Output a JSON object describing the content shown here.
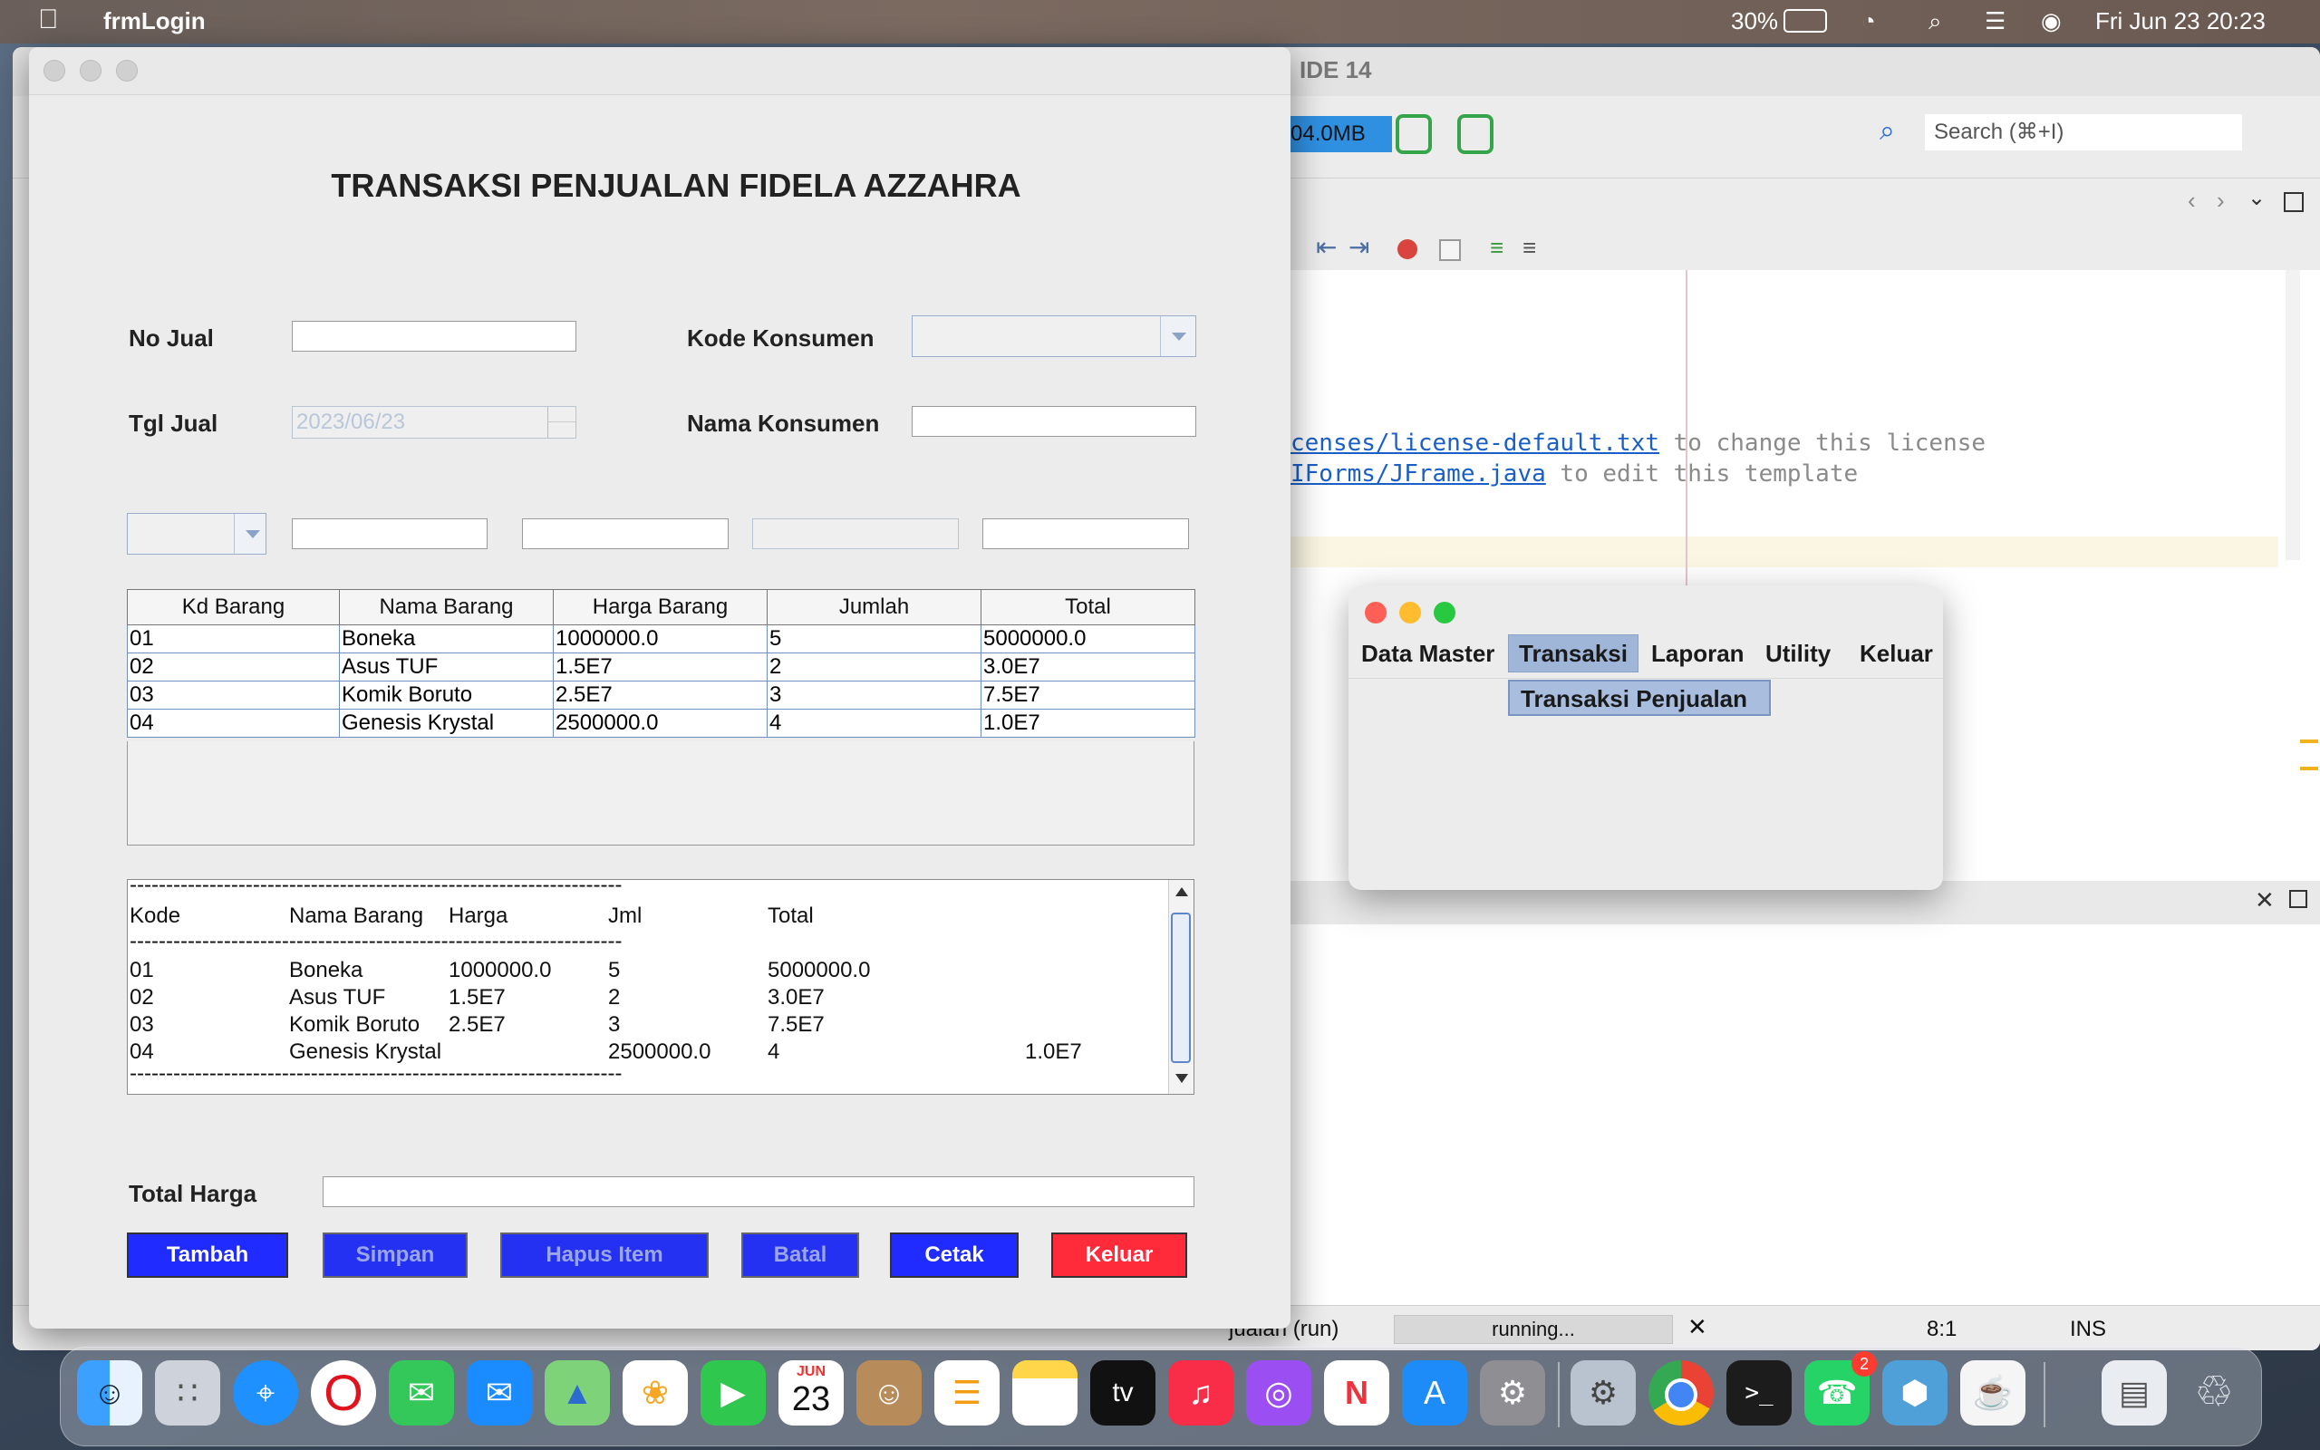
{
  "menubar": {
    "app_name": "frmLogin",
    "battery": "30%",
    "datetime": "Fri Jun 23  20:23"
  },
  "ide": {
    "title": "IDE 14",
    "memory": "04.0MB",
    "search_placeholder": "Search (⌘+I)",
    "code_line1_link": "censes/license-default.txt",
    "code_line1_rest": " to change this license",
    "code_line2_link": "IForms/JFrame.java",
    "code_line2_rest": " to edit this template",
    "status_run": "jualan (run)",
    "status_running": "running...",
    "status_pos": "8:1",
    "status_ins": "INS"
  },
  "form": {
    "title": "TRANSAKSI PENJUALAN FIDELA AZZAHRA",
    "labels": {
      "no_jual": "No Jual",
      "kode_konsumen": "Kode Konsumen",
      "tgl_jual": "Tgl Jual",
      "nama_konsumen": "Nama Konsumen",
      "total_harga": "Total Harga"
    },
    "tgl_jual_value": "2023/06/23",
    "table": {
      "headers": [
        "Kd Barang",
        "Nama Barang",
        "Harga Barang",
        "Jumlah",
        "Total"
      ],
      "rows": [
        [
          "01",
          "Boneka",
          "1000000.0",
          "5",
          "5000000.0"
        ],
        [
          "02",
          "Asus TUF",
          "1.5E7",
          "2",
          "3.0E7"
        ],
        [
          "03",
          "Komik Boruto",
          "2.5E7",
          "3",
          "7.5E7"
        ],
        [
          "04",
          "Genesis Krystal",
          "2500000.0",
          "4",
          "1.0E7"
        ]
      ]
    },
    "receipt": {
      "divider": "--------------------------------------------------------------------",
      "header": [
        "Kode",
        "Nama Barang",
        "Harga",
        "Jml",
        "Total"
      ],
      "rows": [
        [
          "01",
          "Boneka",
          "1000000.0",
          "5",
          "5000000.0"
        ],
        [
          "02",
          "Asus TUF",
          "1.5E7",
          "2",
          "3.0E7"
        ],
        [
          "03",
          "Komik Boruto",
          "2.5E7",
          "3",
          "7.5E7"
        ]
      ],
      "row4": [
        "04",
        "Genesis Krystal",
        "2500000.0",
        "4",
        "1.0E7"
      ]
    },
    "buttons": {
      "tambah": "Tambah",
      "simpan": "Simpan",
      "hapus": "Hapus Item",
      "batal": "Batal",
      "cetak": "Cetak",
      "keluar": "Keluar"
    }
  },
  "mini": {
    "menus": [
      "Data Master",
      "Transaksi",
      "Laporan",
      "Utility",
      "Keluar"
    ],
    "dropdown_item": "Transaksi Penjualan"
  },
  "dock": {
    "calendar_month": "JUN",
    "calendar_day": "23",
    "whatsapp_badge": "2",
    "tv_label": "tv"
  },
  "colors": {
    "button_blue": "#1f2bff",
    "button_red": "#ff2b3a",
    "selection": "#9fb6d8"
  }
}
